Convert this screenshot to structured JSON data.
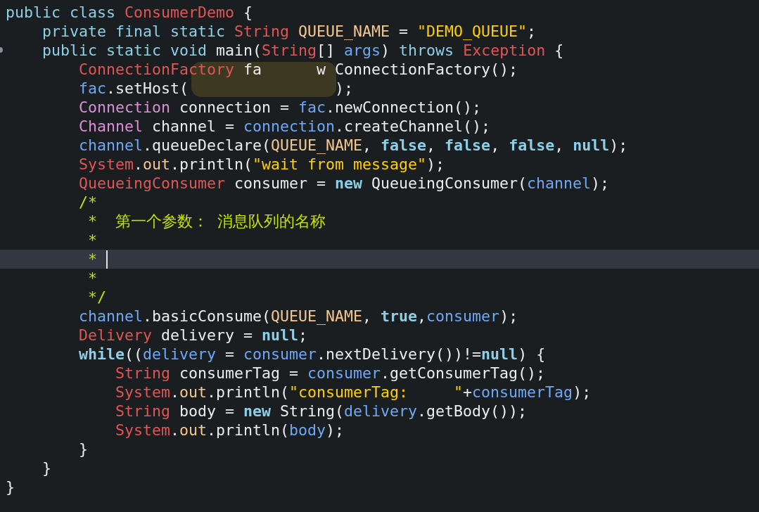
{
  "editor": {
    "mosaic": true,
    "lines": [
      {
        "current": false,
        "marker": false,
        "tokens": [
          {
            "kind": "kw",
            "text": "public class "
          },
          {
            "kind": "type",
            "text": "ConsumerDemo"
          },
          {
            "kind": "plain",
            "text": " {"
          }
        ]
      },
      {
        "current": false,
        "marker": false,
        "tokens": [
          {
            "kind": "kw",
            "text": "    private final static "
          },
          {
            "kind": "type",
            "text": "String"
          },
          {
            "kind": "const",
            "text": " QUEUE_NAME"
          },
          {
            "kind": "plain",
            "text": " = "
          },
          {
            "kind": "str",
            "text": "\"DEMO_QUEUE\""
          },
          {
            "kind": "plain",
            "text": ";"
          }
        ]
      },
      {
        "current": false,
        "marker": true,
        "tokens": [
          {
            "kind": "kw",
            "text": "    public static void "
          },
          {
            "kind": "plain",
            "text": "main("
          },
          {
            "kind": "type",
            "text": "String"
          },
          {
            "kind": "plain",
            "text": "[] "
          },
          {
            "kind": "var",
            "text": "args"
          },
          {
            "kind": "plain",
            "text": ") "
          },
          {
            "kind": "kw",
            "text": "throws "
          },
          {
            "kind": "type",
            "text": "Exception"
          },
          {
            "kind": "plain",
            "text": " {"
          }
        ]
      },
      {
        "current": false,
        "marker": false,
        "tokens": [
          {
            "kind": "type",
            "text": "        ConnectionFactory"
          },
          {
            "kind": "plain",
            "text": " fa      w ConnectionFactory();"
          }
        ]
      },
      {
        "current": false,
        "marker": false,
        "tokens": [
          {
            "kind": "var",
            "text": "        fac"
          },
          {
            "kind": "plain",
            "text": ".setHost(                );"
          }
        ]
      },
      {
        "current": false,
        "marker": false,
        "tokens": [
          {
            "kind": "type2",
            "text": "        Connection"
          },
          {
            "kind": "plain",
            "text": " connection = "
          },
          {
            "kind": "var",
            "text": "fac"
          },
          {
            "kind": "plain",
            "text": ".newConnection();"
          }
        ]
      },
      {
        "current": false,
        "marker": false,
        "tokens": [
          {
            "kind": "type2",
            "text": "        Channel"
          },
          {
            "kind": "plain",
            "text": " channel = "
          },
          {
            "kind": "var",
            "text": "connection"
          },
          {
            "kind": "plain",
            "text": ".createChannel();"
          }
        ]
      },
      {
        "current": false,
        "marker": false,
        "tokens": [
          {
            "kind": "var",
            "text": "        channel"
          },
          {
            "kind": "plain",
            "text": ".queueDeclare("
          },
          {
            "kind": "const",
            "text": "QUEUE_NAME"
          },
          {
            "kind": "plain",
            "text": ", "
          },
          {
            "kind": "kwb",
            "text": "false"
          },
          {
            "kind": "plain",
            "text": ", "
          },
          {
            "kind": "kwb",
            "text": "false"
          },
          {
            "kind": "plain",
            "text": ", "
          },
          {
            "kind": "kwb",
            "text": "false"
          },
          {
            "kind": "plain",
            "text": ", "
          },
          {
            "kind": "kwb",
            "text": "null"
          },
          {
            "kind": "plain",
            "text": ");"
          }
        ]
      },
      {
        "current": false,
        "marker": false,
        "tokens": [
          {
            "kind": "type",
            "text": "        System"
          },
          {
            "kind": "plain",
            "text": "."
          },
          {
            "kind": "const",
            "text": "out"
          },
          {
            "kind": "plain",
            "text": ".println("
          },
          {
            "kind": "str",
            "text": "\"wait from message\""
          },
          {
            "kind": "plain",
            "text": ");"
          }
        ]
      },
      {
        "current": false,
        "marker": false,
        "tokens": [
          {
            "kind": "type",
            "text": "        QueueingConsumer"
          },
          {
            "kind": "plain",
            "text": " consumer = "
          },
          {
            "kind": "kwb",
            "text": "new"
          },
          {
            "kind": "plain",
            "text": " QueueingConsumer("
          },
          {
            "kind": "var",
            "text": "channel"
          },
          {
            "kind": "plain",
            "text": ");"
          }
        ]
      },
      {
        "current": false,
        "marker": false,
        "tokens": [
          {
            "kind": "comment",
            "text": "        /*"
          }
        ]
      },
      {
        "current": false,
        "marker": false,
        "tokens": [
          {
            "kind": "comment",
            "text": "         *  第一个参数： 消息队列的名称"
          }
        ]
      },
      {
        "current": false,
        "marker": false,
        "tokens": [
          {
            "kind": "comment",
            "text": "         *"
          }
        ]
      },
      {
        "current": true,
        "marker": false,
        "tokens": [
          {
            "kind": "comment",
            "text": "         * "
          }
        ]
      },
      {
        "current": false,
        "marker": false,
        "tokens": [
          {
            "kind": "comment",
            "text": "         *"
          }
        ]
      },
      {
        "current": false,
        "marker": false,
        "tokens": [
          {
            "kind": "comment",
            "text": "         */"
          }
        ]
      },
      {
        "current": false,
        "marker": false,
        "tokens": [
          {
            "kind": "var",
            "text": "        channel"
          },
          {
            "kind": "plain",
            "text": ".basicConsume("
          },
          {
            "kind": "const",
            "text": "QUEUE_NAME"
          },
          {
            "kind": "plain",
            "text": ", "
          },
          {
            "kind": "kwb",
            "text": "true"
          },
          {
            "kind": "plain",
            "text": ","
          },
          {
            "kind": "var",
            "text": "consumer"
          },
          {
            "kind": "plain",
            "text": ");"
          }
        ]
      },
      {
        "current": false,
        "marker": false,
        "tokens": [
          {
            "kind": "type",
            "text": "        Delivery"
          },
          {
            "kind": "plain",
            "text": " delivery = "
          },
          {
            "kind": "kwb",
            "text": "null"
          },
          {
            "kind": "plain",
            "text": ";"
          }
        ]
      },
      {
        "current": false,
        "marker": false,
        "tokens": [
          {
            "kind": "kwb",
            "text": "        while"
          },
          {
            "kind": "plain",
            "text": "(("
          },
          {
            "kind": "var",
            "text": "delivery"
          },
          {
            "kind": "plain",
            "text": " = "
          },
          {
            "kind": "var",
            "text": "consumer"
          },
          {
            "kind": "plain",
            "text": ".nextDelivery())!="
          },
          {
            "kind": "kwb",
            "text": "null"
          },
          {
            "kind": "plain",
            "text": ") {"
          }
        ]
      },
      {
        "current": false,
        "marker": false,
        "tokens": [
          {
            "kind": "type",
            "text": "            String"
          },
          {
            "kind": "plain",
            "text": " consumerTag = "
          },
          {
            "kind": "var",
            "text": "consumer"
          },
          {
            "kind": "plain",
            "text": ".getConsumerTag();"
          }
        ]
      },
      {
        "current": false,
        "marker": false,
        "tokens": [
          {
            "kind": "type",
            "text": "            System"
          },
          {
            "kind": "plain",
            "text": "."
          },
          {
            "kind": "const",
            "text": "out"
          },
          {
            "kind": "plain",
            "text": ".println("
          },
          {
            "kind": "str",
            "text": "\"consumerTag:     \""
          },
          {
            "kind": "plain",
            "text": "+"
          },
          {
            "kind": "var",
            "text": "consumerTag"
          },
          {
            "kind": "plain",
            "text": ");"
          }
        ]
      },
      {
        "current": false,
        "marker": false,
        "tokens": [
          {
            "kind": "type",
            "text": "            String"
          },
          {
            "kind": "plain",
            "text": " body = "
          },
          {
            "kind": "kwb",
            "text": "new"
          },
          {
            "kind": "plain",
            "text": " String("
          },
          {
            "kind": "var",
            "text": "delivery"
          },
          {
            "kind": "plain",
            "text": ".getBody());"
          }
        ]
      },
      {
        "current": false,
        "marker": false,
        "tokens": [
          {
            "kind": "type",
            "text": "            System"
          },
          {
            "kind": "plain",
            "text": "."
          },
          {
            "kind": "const",
            "text": "out"
          },
          {
            "kind": "plain",
            "text": ".println("
          },
          {
            "kind": "var",
            "text": "body"
          },
          {
            "kind": "plain",
            "text": ");"
          }
        ]
      },
      {
        "current": false,
        "marker": false,
        "tokens": [
          {
            "kind": "plain",
            "text": "        }"
          }
        ]
      },
      {
        "current": false,
        "marker": false,
        "tokens": [
          {
            "kind": "plain",
            "text": "    }"
          }
        ]
      },
      {
        "current": false,
        "marker": false,
        "tokens": [
          {
            "kind": "plain",
            "text": "}"
          }
        ]
      }
    ]
  }
}
